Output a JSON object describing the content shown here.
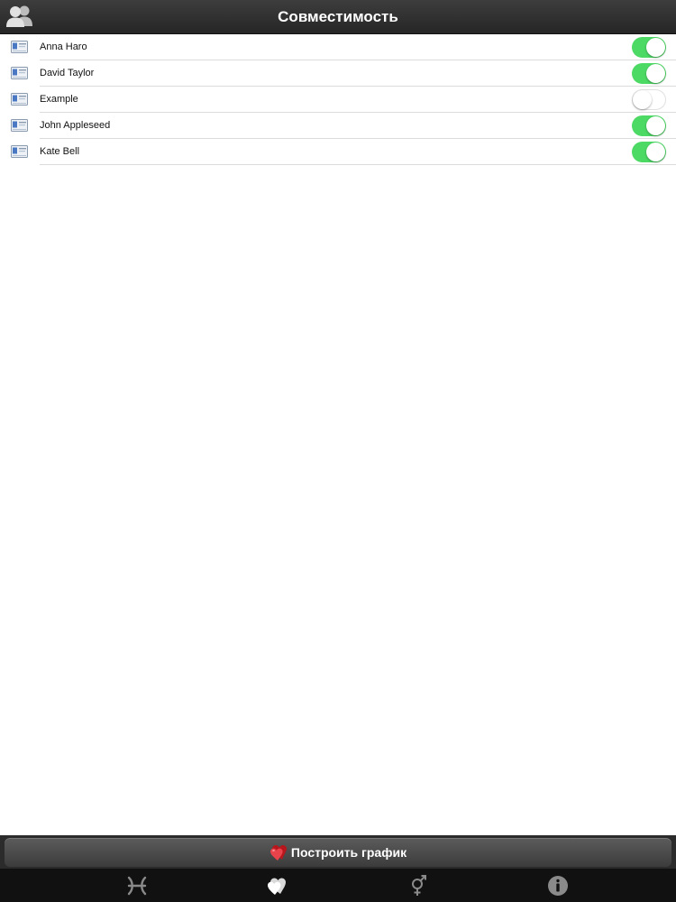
{
  "header": {
    "title": "Совместимость",
    "contacts_icon": "people-icon"
  },
  "contacts": [
    {
      "name": "Anna Haro",
      "enabled": true
    },
    {
      "name": "David Taylor",
      "enabled": true
    },
    {
      "name": "Example",
      "enabled": false
    },
    {
      "name": "John Appleseed",
      "enabled": true
    },
    {
      "name": "Kate Bell",
      "enabled": true
    }
  ],
  "action": {
    "label": "Построить график",
    "icon": "hearts-icon"
  },
  "tabs": [
    {
      "icon": "zodiac-icon",
      "selected": false
    },
    {
      "icon": "hearts-icon",
      "selected": true
    },
    {
      "icon": "gender-icon",
      "selected": false
    },
    {
      "icon": "info-icon",
      "selected": false
    }
  ],
  "colors": {
    "toggle_on": "#4cd964",
    "navbar": "#2f2f2f",
    "tabbar": "#111111"
  }
}
